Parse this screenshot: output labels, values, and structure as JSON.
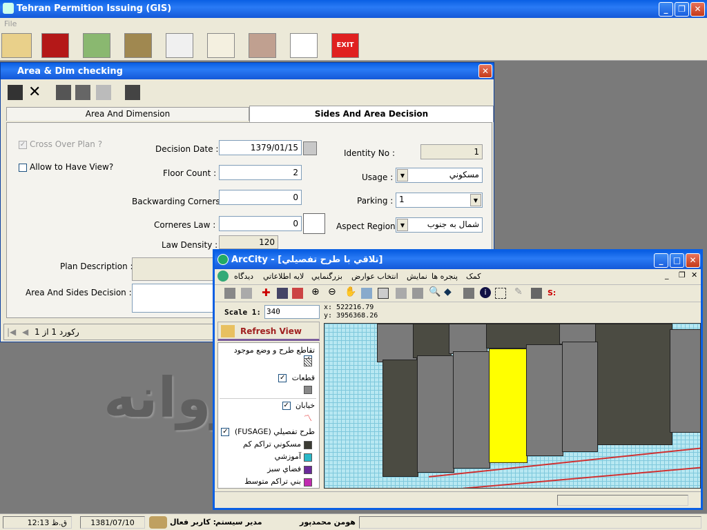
{
  "app": {
    "title": "Tehran Permition Issuing (GIS)",
    "menu_file": "File"
  },
  "dialog": {
    "title": "Area & Dim checking",
    "tab1": "Area And Dimension",
    "tab2": "Sides And Area Decision",
    "cross_over": "Cross Over Plan ?",
    "allow_view": "Allow to Have View?",
    "decision_date_label": "Decision Date :",
    "decision_date": "1379/01/15",
    "floor_count_label": "Floor Count :",
    "floor_count": "2",
    "backwarding_label": "Backwarding Corners",
    "backwarding": "0",
    "corners_law_label": "Corneres Law :",
    "corners_law": "0",
    "law_density_label": "Law Density :",
    "law_density": "120",
    "identity_label": "Identity No :",
    "identity": "1",
    "usage_label": "Usage :",
    "usage": "مسکوني",
    "parking_label": "Parking :",
    "parking": "1",
    "aspect_label": "Aspect Region",
    "aspect": "شمال به جنوب",
    "plan_desc_label": "Plan Description :",
    "sides_label": "Area And Sides Decision :",
    "record": "رکورد 1 از 1"
  },
  "arccity": {
    "title": "ArcCity - [تلاقي با طرح تفصيلي]",
    "menu": [
      "کمک",
      "پنجره ها",
      "نمايش",
      "انتخاب عوارض",
      "بزرگنمايي",
      "لايه اطلاعاتي",
      "ديدگاه"
    ],
    "scale_label": "Scale 1:",
    "scale": "340",
    "x": "x: 522216.79",
    "y": "y: 3956368.26",
    "refresh": "Refresh View",
    "s_label": "S:",
    "layers": [
      "تقاطع طرح و وضع موجود",
      "قطعات",
      "خيابان",
      "طرح تفصيلي (FUSAGE)"
    ],
    "legend": [
      "مسکوني تراکم کم",
      "آموزشي",
      "فضاي سبز",
      "بني تراکم متوسط"
    ]
  },
  "status": {
    "time": "12:13 ق.ظ",
    "date": "1381/07/10",
    "active_user": ": کاربر فعال",
    "role": "مدير سيستم",
    "name": "هومن محمدپور"
  },
  "watermark": "پروانه",
  "colors": {
    "title_blue": "#0a5fe3",
    "map_dark": "#4b4b42",
    "map_gray": "#7a7a7a",
    "highlight": "#ffff00",
    "grid": "#b0e4f0",
    "legend1": "#3b3b33",
    "legend2": "#2ab8c8",
    "legend3": "#6a2a9a",
    "legend4": "#c02ab0"
  }
}
